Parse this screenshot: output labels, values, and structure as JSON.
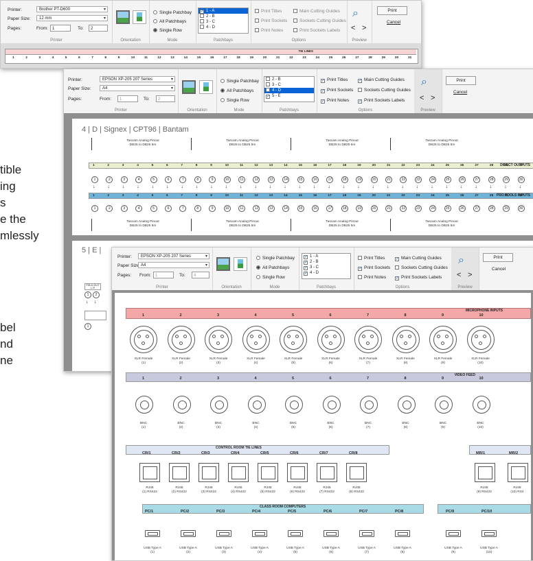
{
  "background_text": [
    "tible",
    "ing",
    "s",
    "e the",
    "mlessly",
    "bel",
    "nd",
    "ne"
  ],
  "window1": {
    "printer_label": "Printer:",
    "printer_value": "Brother PT-D600",
    "paper_label": "Paper Size:",
    "paper_value": "12 mm",
    "pages_label": "Pages:",
    "from_label": "From:",
    "from_value": "1",
    "to_label": "To:",
    "to_value": "2",
    "group_printer": "Printer",
    "group_orientation": "Orientation",
    "group_mode": "Mode",
    "group_patchbays": "Patchbays",
    "group_options": "Options",
    "group_preview": "Preview",
    "mode_single": "Single Patchbay",
    "mode_all": "All Patchbays",
    "mode_row": "Single Row",
    "patchbays": [
      "1 - A",
      "2 - B",
      "3 - C",
      "4 - D"
    ],
    "opt_titles": "Print Titles",
    "opt_sockets": "Print Sockets",
    "opt_notes": "Print Notes",
    "opt_main": "Main Cutting Guides",
    "opt_sockets_cut": "Sockets Cutting Guides",
    "opt_labels": "Print Sockets Labels",
    "print": "Print",
    "cancel": "Cancel",
    "strip_title": "TIE LINES",
    "strip_numbers": [
      "1",
      "2",
      "3",
      "4",
      "5",
      "6",
      "7",
      "8",
      "9",
      "10",
      "11",
      "12",
      "13",
      "14",
      "15",
      "16",
      "17",
      "18",
      "19",
      "20",
      "21",
      "22",
      "23",
      "24",
      "25",
      "26",
      "27",
      "28",
      "29",
      "30",
      "31"
    ]
  },
  "window2": {
    "printer_label": "Printer:",
    "printer_value": "EPSON XP-205 207 Series",
    "paper_label": "Paper Size:",
    "paper_value": "A4",
    "pages_label": "Pages:",
    "from_label": "From:",
    "from_value": "1",
    "to_label": "To:",
    "to_value": "2",
    "group_printer": "Printer",
    "group_orientation": "Orientation",
    "group_mode": "Mode",
    "group_patchbays": "Patchbays",
    "group_options": "Options",
    "group_preview": "Preview",
    "mode_single": "Single Patchbay",
    "mode_all": "All Patchbays",
    "mode_row": "Single Row",
    "patchbays": [
      "2 - B",
      "3 - C",
      "4 - D",
      "5 - E"
    ],
    "opt_titles": "Print Titles",
    "opt_sockets": "Print Sockets",
    "opt_notes": "Print Notes",
    "opt_main": "Main Cutting Guides",
    "opt_sockets_cut": "Sockets Cutting Guides",
    "opt_labels": "Print Sockets Labels",
    "print": "Print",
    "cancel": "Cancel",
    "sheet_title": "4 | D | Signex | CPT96 | Bantam",
    "pinout_title": "Tascam Analog Pinout",
    "pinout_sub": "DB25 to DB25 5m",
    "band1_title": "DIRECT OUTPUTS",
    "band2_title": "PRO TOOLS INPUTS",
    "numbers": [
      "1",
      "2",
      "3",
      "4",
      "5",
      "6",
      "7",
      "8",
      "9",
      "10",
      "11",
      "12",
      "13",
      "14",
      "15",
      "16",
      "17",
      "18",
      "19",
      "20",
      "21",
      "22",
      "23",
      "24",
      "25",
      "26",
      "27",
      "28",
      "29",
      "30"
    ],
    "next_sheet_title": "5 | E |",
    "fb_label": "F/B A OUT",
    "fb_cols": [
      "L",
      "R"
    ],
    "fb_circ": [
      "1",
      "2",
      "1"
    ]
  },
  "window3": {
    "printer_label": "Printer:",
    "printer_value": "EPSON XP-205 207 Series",
    "paper_label": "Paper Size:",
    "paper_value": "A4",
    "pages_label": "Pages:",
    "from_label": "From:",
    "from_value": "1",
    "to_label": "To:",
    "to_value": "4",
    "group_printer": "Printer",
    "group_orientation": "Orientation",
    "group_mode": "Mode",
    "group_patchbays": "Patchbays",
    "group_options": "Options",
    "group_preview": "Preview",
    "mode_single": "Single Patchbay",
    "mode_all": "All Patchbays",
    "mode_row": "Single Row",
    "patchbays": [
      "1 - A",
      "2 - B",
      "3 - C",
      "4 - D"
    ],
    "opt_titles": "Print Titles",
    "opt_sockets": "Print Sockets",
    "opt_notes": "Print Notes",
    "opt_main": "Main Cutting Guides",
    "opt_sockets_cut": "Sockets Cutting Guides",
    "opt_labels": "Print Sockets Labels",
    "print": "Print",
    "cancel": "Cancel",
    "mic_title": "MICROPHONE INPUTS",
    "mic_numbers": [
      "1",
      "2",
      "3",
      "4",
      "5",
      "6",
      "7",
      "8",
      "9",
      "10"
    ],
    "mic_labels": [
      "XLR Female\n(1)",
      "XLR Female\n(2)",
      "XLR Female\n(3)",
      "XLR Female\n(4)",
      "XLR Female\n(5)",
      "XLR Female\n(6)",
      "XLR Female\n(7)",
      "XLR Female\n(8)",
      "XLR Female\n(9)",
      "XLR Female\n(10)"
    ],
    "video_title": "VIDEO FEED",
    "video_numbers": [
      "1",
      "2",
      "3",
      "4",
      "5",
      "6",
      "7",
      "8",
      "9",
      "10"
    ],
    "bnc_labels": [
      "BNC\n(1)",
      "BNC\n(2)",
      "BNC\n(3)",
      "BNC\n(4)",
      "BNC\n(5)",
      "BNC\n(6)",
      "BNC\n(7)",
      "BNC\n(8)",
      "BNC\n(9)",
      "BNC\n(10)"
    ],
    "ctrl_title": "CONTROL ROOM TIE LINES",
    "ctrl_labels": [
      "CR/1",
      "CR/2",
      "CR/3",
      "CR/4",
      "CR/5",
      "CR/6",
      "CR/7",
      "CR/8"
    ],
    "mr_labels": [
      "MR/1",
      "MR/2"
    ],
    "rj_labels": [
      "RJ45\n(1) RS422",
      "RJ45\n(2) RS422",
      "RJ45\n(3) RS422",
      "RJ45\n(4) RS422",
      "RJ45\n(5) RS422",
      "RJ45\n(6) RS422",
      "RJ45\n(7) RS422",
      "RJ45\n(8) RS422",
      "RJ45\n(9) RS422",
      "RJ45\n(10) RS4"
    ],
    "class_title": "CLASS ROOM COMPUTERS",
    "pc_labels": [
      "PC/1",
      "PC/2",
      "PC/3",
      "PC/4",
      "PC/5",
      "PC/6",
      "PC/7",
      "PC/8",
      "PC/9",
      "PC/10"
    ],
    "usb_labels": [
      "USB Type A\n(1)",
      "USB Type A\n(2)",
      "USB Type A\n(3)",
      "USB Type A\n(4)",
      "USB Type A\n(5)",
      "USB Type A\n(6)",
      "USB Type A\n(7)",
      "USB Type A\n(8)",
      "USB Type A\n(9)",
      "USB Type A\n(10)"
    ]
  },
  "colors": {
    "mic_band": "#f4a7a7",
    "video_band": "#c9c9dd",
    "ctrl_band": "#dfe7f5",
    "class_band": "#a8dbe6",
    "direct_band": "#e9efcf",
    "protools_band": "#6fb3d9",
    "strip_band": "#f6d4d4"
  }
}
